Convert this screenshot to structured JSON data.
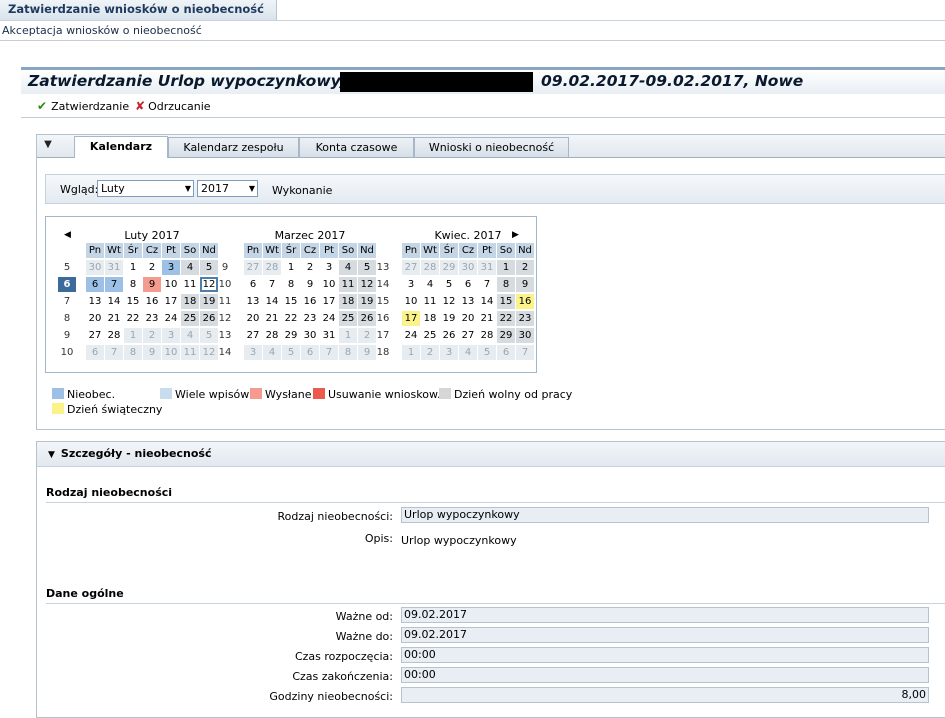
{
  "window": {
    "tab_title": "Zatwierdzanie wniosków o nieobecność",
    "breadcrumb": "Akceptacja wniosków o nieobecność"
  },
  "header": {
    "title_prefix": "Zatwierdzanie Urlop wypoczynkowy,",
    "title_suffix": "09.02.2017-09.02.2017, Nowe"
  },
  "toolbar": {
    "approve_label": "Zatwierdzanie",
    "reject_label": "Odrzucanie"
  },
  "tabs": [
    {
      "label": "Kalendarz",
      "active": true
    },
    {
      "label": "Kalendarz zespołu",
      "active": false
    },
    {
      "label": "Konta czasowe",
      "active": false
    },
    {
      "label": "Wnioski o nieobecność",
      "active": false
    }
  ],
  "filter": {
    "view_label": "Wgląd:",
    "month_value": "Luty",
    "year_value": "2017",
    "execute_label": "Wykonanie"
  },
  "weekday_headers": [
    "Pn",
    "Wt",
    "Śr",
    "Cz",
    "Pt",
    "So",
    "Nd"
  ],
  "months": [
    {
      "title": "Luty 2017",
      "weeks": [
        "5",
        "6",
        "7",
        "8",
        "9",
        "10"
      ],
      "days": [
        [
          [
            "30",
            "out"
          ],
          [
            "31",
            "out"
          ],
          [
            "1",
            ""
          ],
          [
            "2",
            ""
          ],
          [
            "3",
            "abs-b"
          ],
          [
            "4",
            "we"
          ],
          [
            "5",
            "we"
          ]
        ],
        [
          [
            "6",
            "abs-d"
          ],
          [
            "6",
            "abs-b"
          ],
          [
            "7",
            "abs-b"
          ],
          [
            "8",
            ""
          ],
          [
            "9",
            "sent"
          ],
          [
            "10",
            ""
          ],
          [
            "11",
            "we"
          ]
        ],
        [
          [
            "13",
            ""
          ],
          [
            "14",
            ""
          ],
          [
            "15",
            ""
          ],
          [
            "16",
            ""
          ],
          [
            "17",
            ""
          ],
          [
            "18",
            "we"
          ],
          [
            "19",
            "we"
          ]
        ],
        [
          [
            "20",
            ""
          ],
          [
            "21",
            ""
          ],
          [
            "22",
            ""
          ],
          [
            "23",
            ""
          ],
          [
            "24",
            ""
          ],
          [
            "25",
            "we"
          ],
          [
            "26",
            "we"
          ]
        ],
        [
          [
            "27",
            ""
          ],
          [
            "28",
            ""
          ],
          [
            "1",
            "out"
          ],
          [
            "2",
            "out"
          ],
          [
            "3",
            "out"
          ],
          [
            "4",
            "out"
          ],
          [
            "5",
            "out"
          ]
        ],
        [
          [
            "6",
            "out"
          ],
          [
            "7",
            "out"
          ],
          [
            "8",
            "out"
          ],
          [
            "9",
            "out"
          ],
          [
            "10",
            "out"
          ],
          [
            "11",
            "out"
          ],
          [
            "12",
            "out"
          ]
        ]
      ]
    },
    {
      "title": "Marzec 2017",
      "weeks": [
        "9",
        "10",
        "11",
        "12",
        "13",
        "14"
      ],
      "days": [
        [
          [
            "27",
            "out"
          ],
          [
            "28",
            "out"
          ],
          [
            "1",
            ""
          ],
          [
            "2",
            ""
          ],
          [
            "3",
            ""
          ],
          [
            "4",
            "we"
          ],
          [
            "5",
            "we"
          ]
        ],
        [
          [
            "6",
            ""
          ],
          [
            "7",
            ""
          ],
          [
            "8",
            ""
          ],
          [
            "9",
            ""
          ],
          [
            "10",
            ""
          ],
          [
            "11",
            "we"
          ],
          [
            "12",
            "we"
          ]
        ],
        [
          [
            "13",
            ""
          ],
          [
            "14",
            ""
          ],
          [
            "15",
            ""
          ],
          [
            "16",
            ""
          ],
          [
            "17",
            ""
          ],
          [
            "18",
            "we"
          ],
          [
            "19",
            "we"
          ]
        ],
        [
          [
            "20",
            ""
          ],
          [
            "21",
            ""
          ],
          [
            "22",
            ""
          ],
          [
            "23",
            ""
          ],
          [
            "24",
            ""
          ],
          [
            "25",
            "we"
          ],
          [
            "26",
            "we"
          ]
        ],
        [
          [
            "27",
            ""
          ],
          [
            "28",
            ""
          ],
          [
            "29",
            ""
          ],
          [
            "30",
            ""
          ],
          [
            "31",
            ""
          ],
          [
            "1",
            "out"
          ],
          [
            "2",
            "out"
          ]
        ],
        [
          [
            "3",
            "out"
          ],
          [
            "4",
            "out"
          ],
          [
            "5",
            "out"
          ],
          [
            "6",
            "out"
          ],
          [
            "7",
            "out"
          ],
          [
            "8",
            "out"
          ],
          [
            "9",
            "out"
          ]
        ]
      ]
    },
    {
      "title": "Kwiec. 2017",
      "weeks": [
        "13",
        "14",
        "15",
        "16",
        "17",
        "18"
      ],
      "days": [
        [
          [
            "27",
            "out"
          ],
          [
            "28",
            "out"
          ],
          [
            "29",
            "out"
          ],
          [
            "30",
            "out"
          ],
          [
            "31",
            "out"
          ],
          [
            "1",
            "we"
          ],
          [
            "2",
            "we"
          ]
        ],
        [
          [
            "3",
            ""
          ],
          [
            "4",
            ""
          ],
          [
            "5",
            ""
          ],
          [
            "6",
            ""
          ],
          [
            "7",
            ""
          ],
          [
            "8",
            "we"
          ],
          [
            "9",
            "we"
          ]
        ],
        [
          [
            "10",
            ""
          ],
          [
            "11",
            ""
          ],
          [
            "12",
            ""
          ],
          [
            "13",
            ""
          ],
          [
            "14",
            ""
          ],
          [
            "15",
            "we"
          ],
          [
            "16",
            "hol"
          ]
        ],
        [
          [
            "17",
            "hol"
          ],
          [
            "18",
            ""
          ],
          [
            "19",
            ""
          ],
          [
            "20",
            ""
          ],
          [
            "21",
            ""
          ],
          [
            "22",
            "we"
          ],
          [
            "23",
            "we"
          ]
        ],
        [
          [
            "24",
            ""
          ],
          [
            "25",
            ""
          ],
          [
            "26",
            ""
          ],
          [
            "27",
            ""
          ],
          [
            "28",
            ""
          ],
          [
            "29",
            "we"
          ],
          [
            "30",
            "we"
          ]
        ],
        [
          [
            "1",
            "out"
          ],
          [
            "2",
            "out"
          ],
          [
            "3",
            "out"
          ],
          [
            "4",
            "out"
          ],
          [
            "5",
            "out"
          ],
          [
            "6",
            "out"
          ],
          [
            "7",
            "out"
          ]
        ]
      ]
    }
  ],
  "legend": [
    {
      "label": "Nieobec.",
      "color": "#9dc1e6"
    },
    {
      "label": "Wiele wpisów",
      "color": "#c9dcee"
    },
    {
      "label": "Wysłane",
      "color": "#f49a8f"
    },
    {
      "label": "Usuwanie wnioskow.",
      "color": "#ec5a4d"
    },
    {
      "label": "Dzień wolny od pracy",
      "color": "#d6d6d6"
    },
    {
      "label": "Dzień świąteczny",
      "color": "#fbf38a"
    }
  ],
  "details": {
    "panel_title": "Szczegóły - nieobecność",
    "section1_title": "Rodzaj nieobecności",
    "type_label": "Rodzaj nieobecności:",
    "type_value": "Urlop wypoczynkowy",
    "desc_label": "Opis:",
    "desc_value": "Urlop wypoczynkowy",
    "section2_title": "Dane ogólne",
    "valid_from_label": "Ważne od:",
    "valid_from_value": "09.02.2017",
    "valid_to_label": "Ważne do:",
    "valid_to_value": "09.02.2017",
    "start_label": "Czas rozpoczęcia:",
    "start_value": "00:00",
    "end_label": "Czas zakończenia:",
    "end_value": "00:00",
    "hours_label": "Godziny nieobecności:",
    "hours_value": "8,00"
  }
}
